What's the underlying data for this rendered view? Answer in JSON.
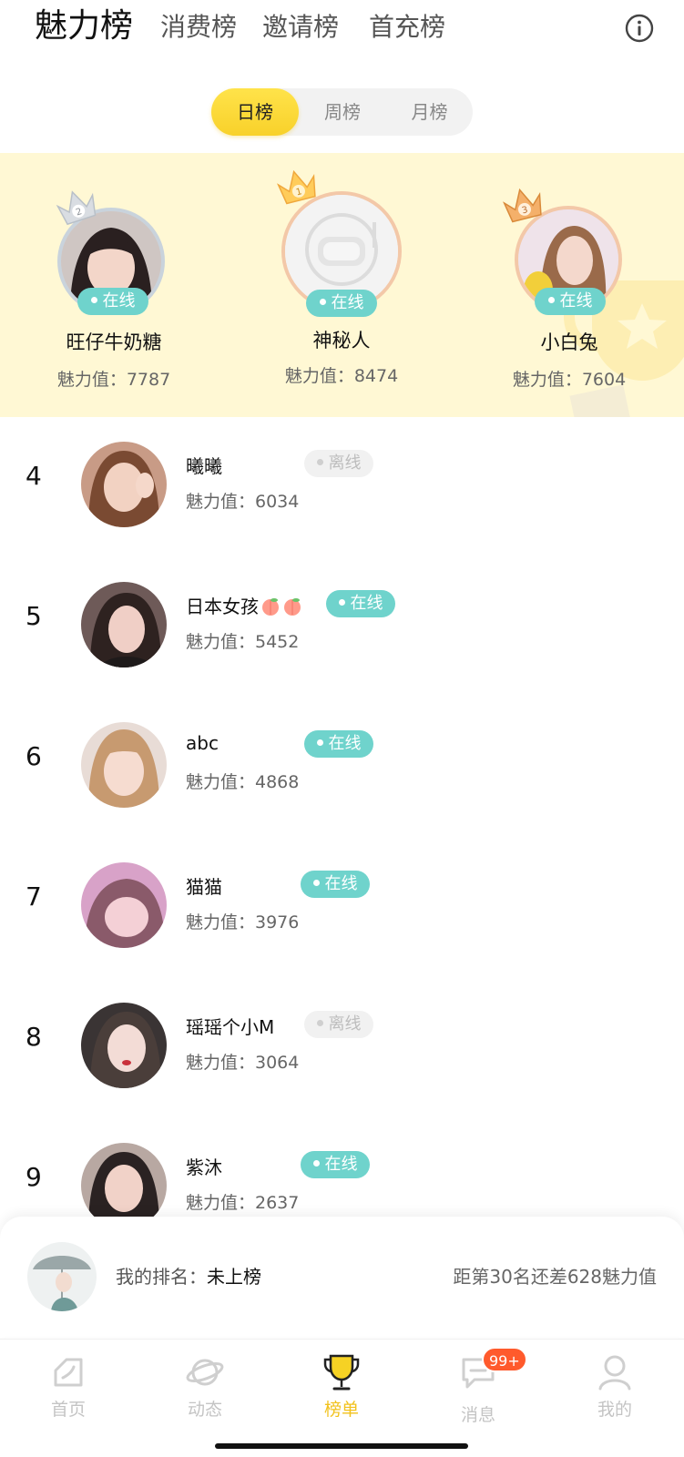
{
  "top_tabs": [
    "魅力榜",
    "消费榜",
    "邀请榜",
    "首充榜"
  ],
  "period_tabs": [
    "日榜",
    "周榜",
    "月榜"
  ],
  "podium": {
    "first": {
      "rank": "1",
      "name": "神秘人",
      "score": "魅力值：8474",
      "status": "在线"
    },
    "second": {
      "rank": "2",
      "name": "旺仔牛奶糖",
      "score": "魅力值：7787",
      "status": "在线"
    },
    "third": {
      "rank": "3",
      "name": "小白兔",
      "score": "魅力值：7604",
      "status": "在线"
    }
  },
  "list": [
    {
      "rank": "4",
      "name": "曦曦",
      "score": "魅力值：6034",
      "status": "离线",
      "online": false
    },
    {
      "rank": "5",
      "name": "日本女孩",
      "score": "魅力值：5452",
      "status": "在线",
      "online": true
    },
    {
      "rank": "6",
      "name": "abc",
      "score": "魅力值：4868",
      "status": "在线",
      "online": true
    },
    {
      "rank": "7",
      "name": "猫猫",
      "score": "魅力值：3976",
      "status": "在线",
      "online": true
    },
    {
      "rank": "8",
      "name": "瑶瑶个小M",
      "score": "魅力值：3064",
      "status": "离线",
      "online": false
    },
    {
      "rank": "9",
      "name": "紫沐",
      "score": "魅力值：2637",
      "status": "在线",
      "online": true
    }
  ],
  "my_rank": {
    "label": "我的排名：",
    "value": "未上榜",
    "gap_text": "距第30名还差628魅力值"
  },
  "bottom_nav": [
    {
      "label": "首页",
      "icon": "home-icon"
    },
    {
      "label": "动态",
      "icon": "planet-icon"
    },
    {
      "label": "榜单",
      "icon": "trophy-icon"
    },
    {
      "label": "消息",
      "icon": "message-icon",
      "badge": "99+"
    },
    {
      "label": "我的",
      "icon": "profile-icon"
    }
  ],
  "colors": {
    "accent_yellow": "#f8d12a",
    "online_teal": "#6fd3cc",
    "podium_bg": "#fff8d4",
    "badge_red": "#ff5a2c"
  }
}
